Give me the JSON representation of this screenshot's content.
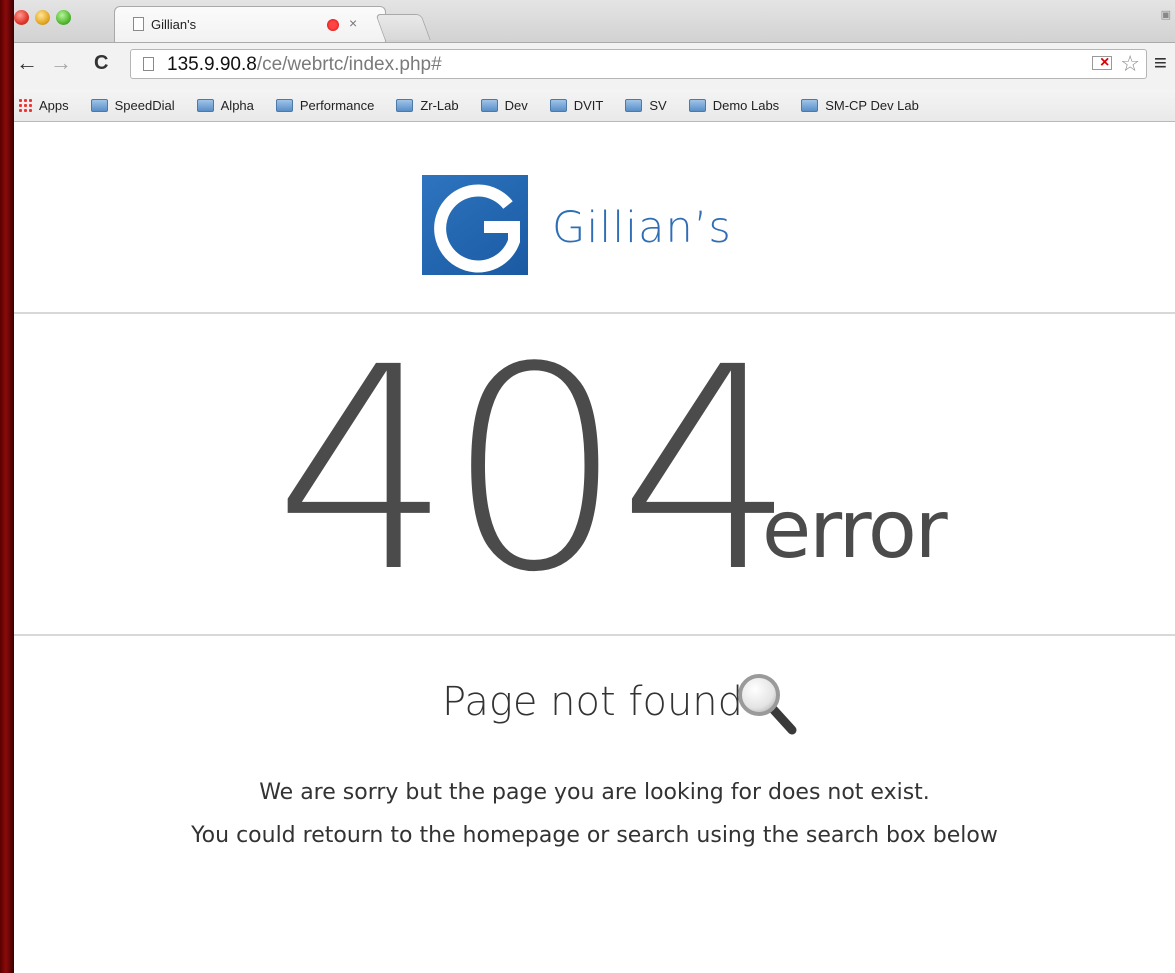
{
  "browser": {
    "tab": {
      "title": "Gillian's"
    },
    "url": {
      "host": "135.9.90.8",
      "path": "/ce/webrtc/index.php#"
    },
    "bookmarks": [
      "Apps",
      "SpeedDial",
      "Alpha",
      "Performance",
      "Zr-Lab",
      "Dev",
      "DVIT",
      "SV",
      "Demo Labs",
      "SM-CP Dev Lab"
    ]
  },
  "page": {
    "brand": {
      "name": "Gillian’s",
      "color": "#2f6db5"
    },
    "error_code": "404",
    "error_word": "error",
    "not_found_title": "Page not found",
    "message_line1": "We are sorry but the page you are looking for does not exist.",
    "message_line2": "You could retourn to the homepage or search using the search box below"
  }
}
